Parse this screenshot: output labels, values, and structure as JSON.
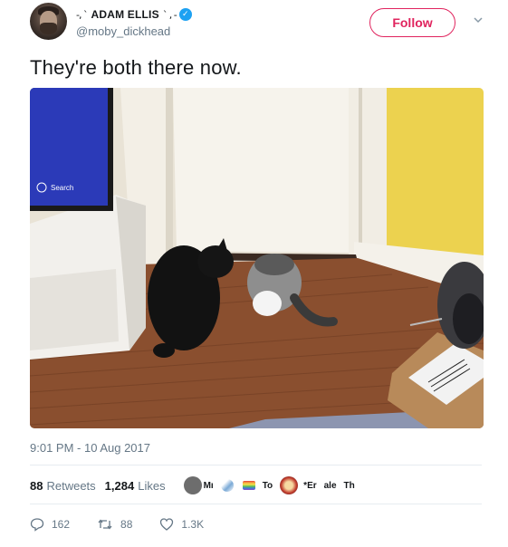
{
  "author": {
    "deco_left": "-, `",
    "display_name": "ADAM ELLIS",
    "deco_right": "` , -",
    "handle": "@moby_dickhead",
    "verified": true
  },
  "follow_label": "Follow",
  "tweet": {
    "text": "They're both there now.",
    "photo_search_label": "Search"
  },
  "timestamp": "9:01 PM - 10 Aug 2017",
  "stats": {
    "retweets_count": "88",
    "retweets_label": "Retweets",
    "likes_count": "1,284",
    "likes_label": "Likes",
    "likers": [
      "Mı",
      "To",
      "*Er",
      "ale",
      "Th"
    ]
  },
  "actions": {
    "replies": "162",
    "retweets": "88",
    "likes": "1.3K"
  },
  "colors": {
    "follow": "#e0245e",
    "verified": "#1da1f2",
    "muted": "#657786"
  }
}
